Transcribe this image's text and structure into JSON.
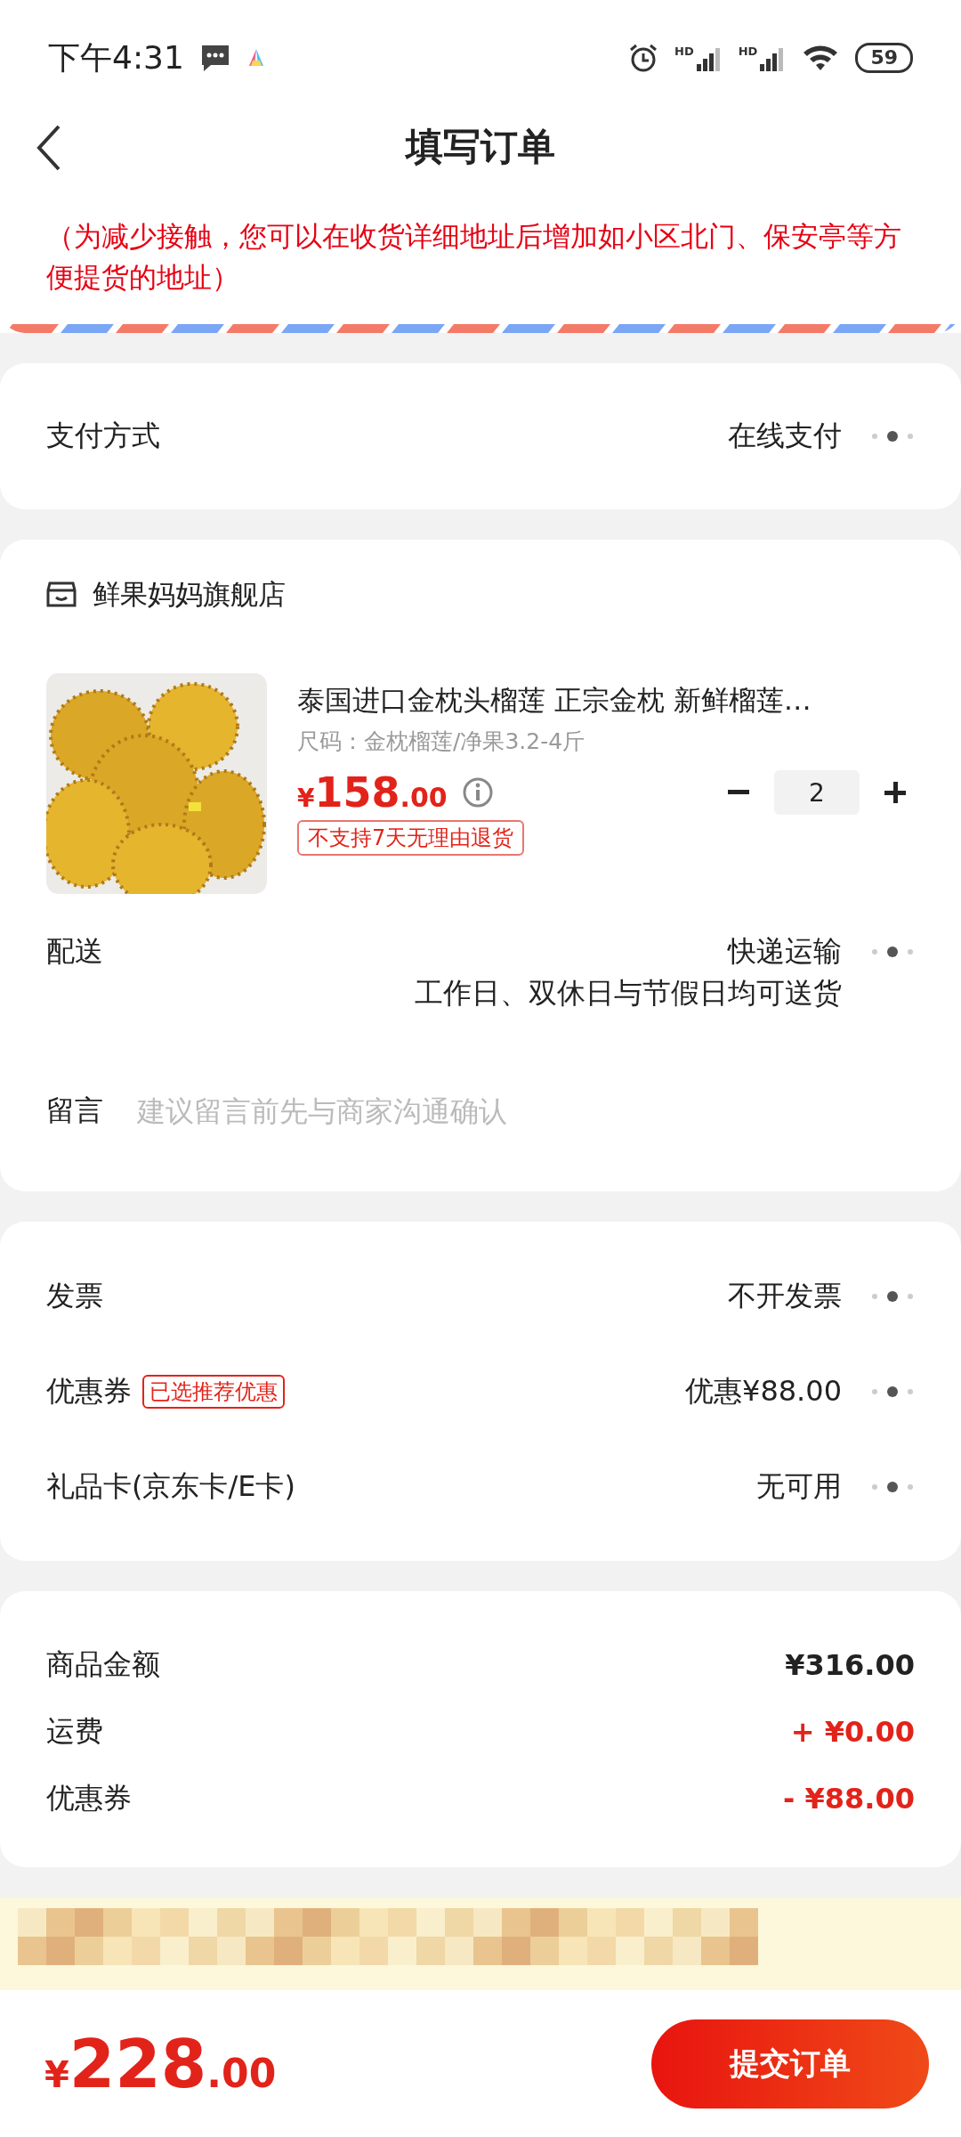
{
  "status_bar": {
    "time": "下午4:31",
    "signal_labels": [
      "HD",
      "HD"
    ],
    "battery": "59"
  },
  "header": {
    "title": "填写订单"
  },
  "address": {
    "notice": "（为减少接触，您可以在收货详细地址后增加如小区北门、保安亭等方便提货的地址）"
  },
  "payment": {
    "label": "支付方式",
    "value": "在线支付"
  },
  "store": {
    "name": "鲜果妈妈旗舰店",
    "product": {
      "title": "泰国进口金枕头榴莲 正宗金枕 新鲜榴莲…",
      "spec": "尺码：金枕榴莲/净果3.2-4斤",
      "price_symbol": "¥",
      "price_int": "158",
      "price_dec": ".00",
      "tag": "不支持7天无理由退货",
      "quantity": "2"
    },
    "delivery": {
      "label": "配送",
      "value": "快递运输",
      "note": "工作日、双休日与节假日均可送货"
    },
    "message": {
      "label": "留言",
      "placeholder": "建议留言前先与商家沟通确认"
    }
  },
  "options": [
    {
      "label": "发票",
      "value": "不开发票"
    },
    {
      "label": "优惠券",
      "badge": "已选推荐优惠",
      "value": "优惠¥88.00"
    },
    {
      "label": "礼品卡(京东卡/E卡)",
      "value": "无可用"
    }
  ],
  "summary": [
    {
      "label": "商品金额",
      "value": "¥316.00",
      "kind": "plain"
    },
    {
      "label": "运费",
      "value": "+ ¥0.00",
      "kind": "accent"
    },
    {
      "label": "优惠券",
      "value": "- ¥88.00",
      "kind": "accent"
    }
  ],
  "footer": {
    "total_symbol": "¥",
    "total_int": "228",
    "total_dec": ".00",
    "submit": "提交订单"
  }
}
